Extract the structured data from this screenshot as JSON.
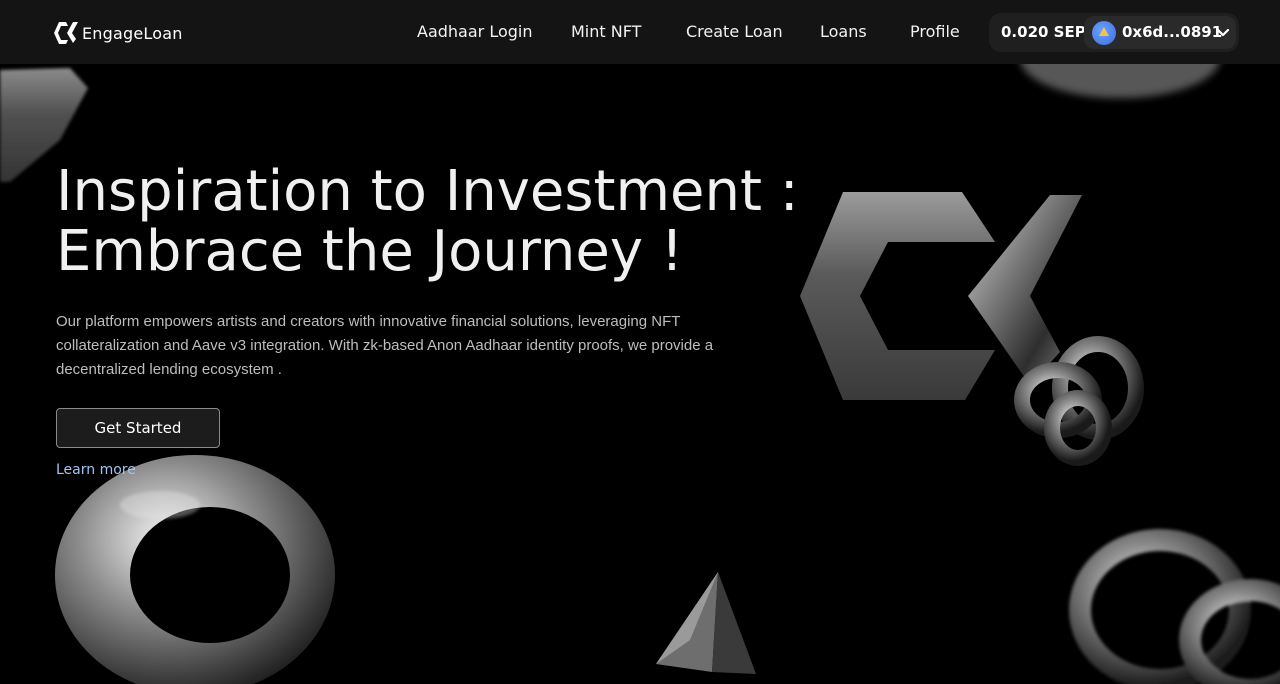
{
  "brand": {
    "name": "EngageLoan",
    "logo_icon": "engageloan-logo-icon"
  },
  "nav": {
    "links": [
      "Aadhaar Login",
      "Mint NFT",
      "Create Loan",
      "Loans",
      "Profile"
    ]
  },
  "wallet": {
    "balance": "0.020 SEP",
    "address": "0x6d...0891",
    "avatar_icon": "wallet-avatar-icon",
    "chevron_icon": "chevron-down-icon"
  },
  "hero": {
    "title_line1": "Inspiration to Investment :",
    "title_line2": "Embrace the Journey !",
    "description": "Our platform empowers artists and creators with innovative financial solutions, leveraging NFT collateralization and Aave v3 integration. With zk-based Anon Aadhaar identity proofs, we provide a decentralized lending ecosystem .",
    "cta_label": "Get Started",
    "learn_more": "Learn more"
  },
  "colors": {
    "background": "#000000",
    "navbar": "#141414",
    "link": "#9ec5f0"
  }
}
